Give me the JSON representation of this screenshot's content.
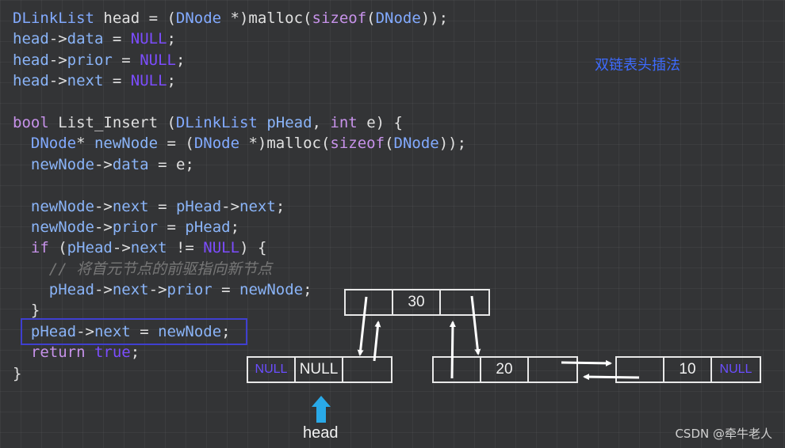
{
  "title": "双链表头插法",
  "code_lines": [
    [
      [
        "ty",
        "DLinkList"
      ],
      [
        "pl",
        " head = ("
      ],
      [
        "ty",
        "DNode"
      ],
      [
        "pl",
        " *)malloc("
      ],
      [
        "kw",
        "sizeof"
      ],
      [
        "pl",
        "("
      ],
      [
        "ty",
        "DNode"
      ],
      [
        "pl",
        "));"
      ]
    ],
    [
      [
        "nm",
        "head"
      ],
      [
        "pl",
        "->"
      ],
      [
        "nm",
        "data"
      ],
      [
        "pl",
        " = "
      ],
      [
        "nu",
        "NULL"
      ],
      [
        "pl",
        ";"
      ]
    ],
    [
      [
        "nm",
        "head"
      ],
      [
        "pl",
        "->"
      ],
      [
        "nm",
        "prior"
      ],
      [
        "pl",
        " = "
      ],
      [
        "nu",
        "NULL"
      ],
      [
        "pl",
        ";"
      ]
    ],
    [
      [
        "nm",
        "head"
      ],
      [
        "pl",
        "->"
      ],
      [
        "nm",
        "next"
      ],
      [
        "pl",
        " = "
      ],
      [
        "nu",
        "NULL"
      ],
      [
        "pl",
        ";"
      ]
    ],
    [],
    [
      [
        "kw",
        "bool"
      ],
      [
        "pl",
        " List_Insert ("
      ],
      [
        "ty",
        "DLinkList"
      ],
      [
        "pl",
        " "
      ],
      [
        "nm",
        "pHead"
      ],
      [
        "pl",
        ", "
      ],
      [
        "kw",
        "int"
      ],
      [
        "pl",
        " e) {"
      ]
    ],
    [
      [
        "pl",
        "  "
      ],
      [
        "ty",
        "DNode"
      ],
      [
        "pl",
        "* "
      ],
      [
        "nm",
        "newNode"
      ],
      [
        "pl",
        " = ("
      ],
      [
        "ty",
        "DNode"
      ],
      [
        "pl",
        " *)malloc("
      ],
      [
        "kw",
        "sizeof"
      ],
      [
        "pl",
        "("
      ],
      [
        "ty",
        "DNode"
      ],
      [
        "pl",
        "));"
      ]
    ],
    [
      [
        "pl",
        "  "
      ],
      [
        "nm",
        "newNode"
      ],
      [
        "pl",
        "->"
      ],
      [
        "nm",
        "data"
      ],
      [
        "pl",
        " = e;"
      ]
    ],
    [],
    [
      [
        "pl",
        "  "
      ],
      [
        "nm",
        "newNode"
      ],
      [
        "pl",
        "->"
      ],
      [
        "nm",
        "next"
      ],
      [
        "pl",
        " = "
      ],
      [
        "nm",
        "pHead"
      ],
      [
        "pl",
        "->"
      ],
      [
        "nm",
        "next"
      ],
      [
        "pl",
        ";"
      ]
    ],
    [
      [
        "pl",
        "  "
      ],
      [
        "nm",
        "newNode"
      ],
      [
        "pl",
        "->"
      ],
      [
        "nm",
        "prior"
      ],
      [
        "pl",
        " = "
      ],
      [
        "nm",
        "pHead"
      ],
      [
        "pl",
        ";"
      ]
    ],
    [
      [
        "pl",
        "  "
      ],
      [
        "kw",
        "if"
      ],
      [
        "pl",
        " ("
      ],
      [
        "nm",
        "pHead"
      ],
      [
        "pl",
        "->"
      ],
      [
        "nm",
        "next"
      ],
      [
        "pl",
        " != "
      ],
      [
        "nu",
        "NULL"
      ],
      [
        "pl",
        ") {"
      ]
    ],
    [
      [
        "pl",
        "    "
      ],
      [
        "cm",
        "// 将首元节点的前驱指向新节点"
      ]
    ],
    [
      [
        "pl",
        "    "
      ],
      [
        "nm",
        "pHead"
      ],
      [
        "pl",
        "->"
      ],
      [
        "nm",
        "next"
      ],
      [
        "pl",
        "->"
      ],
      [
        "nm",
        "prior"
      ],
      [
        "pl",
        " = "
      ],
      [
        "nm",
        "newNode"
      ],
      [
        "pl",
        ";"
      ]
    ],
    [
      [
        "pl",
        "  }"
      ]
    ],
    [
      [
        "pl",
        "  "
      ],
      [
        "nm",
        "pHead"
      ],
      [
        "pl",
        "->"
      ],
      [
        "nm",
        "next"
      ],
      [
        "pl",
        " = "
      ],
      [
        "nm",
        "newNode"
      ],
      [
        "pl",
        ";"
      ]
    ],
    [
      [
        "pl",
        "  "
      ],
      [
        "kw",
        "return"
      ],
      [
        "pl",
        " "
      ],
      [
        "nu",
        "true"
      ],
      [
        "pl",
        ";"
      ]
    ],
    [
      [
        "pl",
        "}"
      ]
    ]
  ],
  "nodes": {
    "head_node": [
      "NULL",
      "NULL",
      ""
    ],
    "new_node": [
      "",
      "30",
      ""
    ],
    "node_20": [
      "",
      "20",
      ""
    ],
    "node_10": [
      "",
      "10",
      "NULL"
    ]
  },
  "head_label": "head",
  "watermark": "CSDN @牵牛老人",
  "colors": {
    "background": "#333436",
    "null": "#6a4dff",
    "keyword": "#c792ea",
    "highlight_box": "#3f3fd0",
    "title": "#3d6bff",
    "head_arrow": "#29a9e8"
  }
}
